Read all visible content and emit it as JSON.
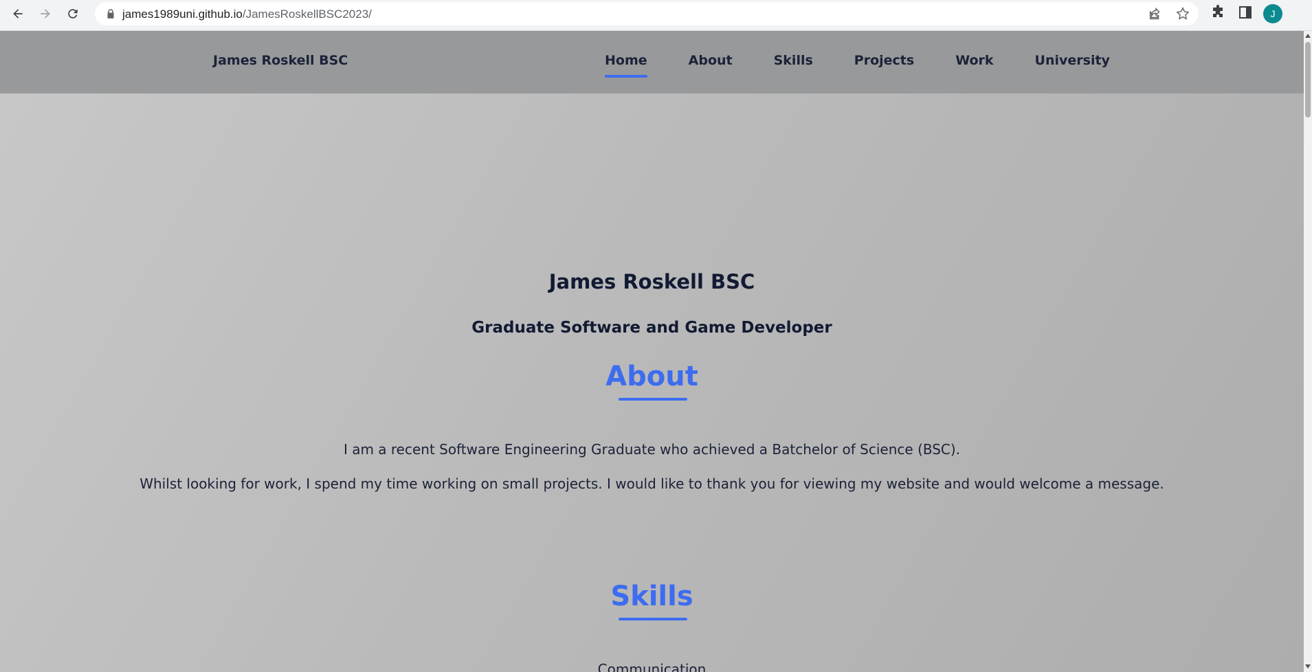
{
  "browser": {
    "url_host": "james1989uni.github.io",
    "url_path": "/JamesRoskellBSC2023/",
    "profile_initial": "J",
    "icons": [
      "back-icon",
      "forward-icon",
      "reload-icon",
      "lock-icon",
      "share-icon",
      "star-icon",
      "extensions-icon",
      "side-panel-icon"
    ]
  },
  "site": {
    "brand": "James Roskell BSC",
    "nav": [
      "Home",
      "About",
      "Skills",
      "Projects",
      "Work",
      "University"
    ],
    "active_nav": "Home"
  },
  "hero": {
    "title": "James Roskell BSC",
    "subtitle": "Graduate Software and Game Developer"
  },
  "about": {
    "heading": "About",
    "line1": "I am a recent Software Engineering Graduate who achieved a Batchelor of Science (BSC).",
    "line2": "Whilst looking for work, I spend my time working on small projects. I would like to thank you for viewing my website and would welcome a message."
  },
  "skills": {
    "heading": "Skills",
    "first_item": "Communication"
  },
  "colors": {
    "accent": "#3d6cf0",
    "header_bg": "#98999b",
    "text_dark": "#1b2238",
    "avatar": "#0b8a8f"
  }
}
